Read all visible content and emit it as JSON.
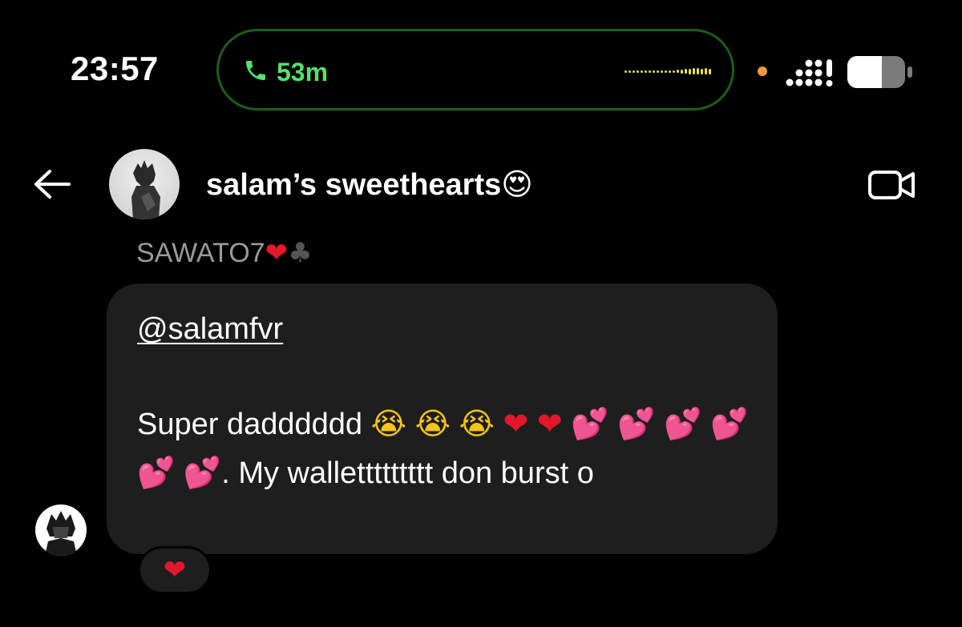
{
  "status_bar": {
    "time": "23:57",
    "call_duration": "53m",
    "icons": [
      "phone-icon",
      "waveform-icon",
      "recording-dot-icon",
      "cellular-signal-icon",
      "battery-icon"
    ],
    "colors": {
      "call_green": "#53e26b",
      "pill_border": "#1f5c1c",
      "waveform": "#e5e04e",
      "recording_dot": "#f09a38"
    }
  },
  "header": {
    "title": "salam’s sweethearts",
    "title_emoji": "😍",
    "icons": [
      "back-arrow-icon",
      "group-avatar",
      "video-call-icon"
    ]
  },
  "message": {
    "sender_name": "SAWATO7",
    "sender_emojis": [
      "❤",
      "♣"
    ],
    "mention": "@salamfvr",
    "text_start": "Super dadddddd",
    "emojis_line1": [
      "😭",
      "😭",
      "😭",
      "❤",
      "❤",
      "💕"
    ],
    "emojis_line2": [
      "💕",
      "💕",
      "💕",
      "💕",
      "💕"
    ],
    "text_end": ". My wallettttttttt don burst o",
    "reaction": "❤"
  },
  "colors": {
    "background": "#000000",
    "bubble": "#1e1e1e",
    "sender_name": "#9a9a9a",
    "heart": "#e2172c"
  }
}
